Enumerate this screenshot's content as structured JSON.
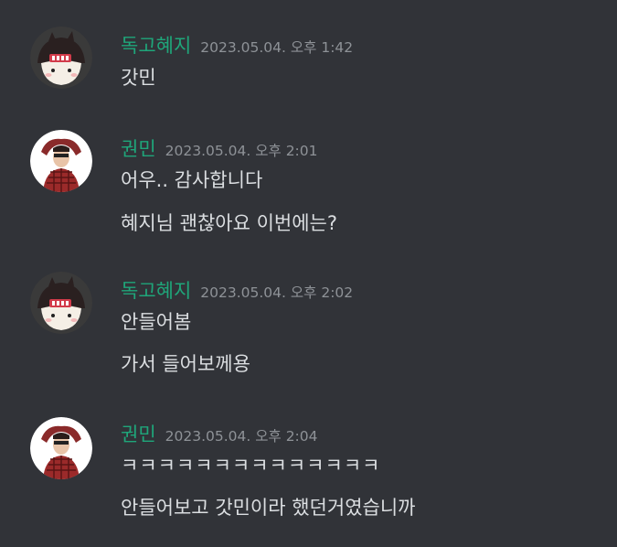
{
  "messages": [
    {
      "author": "독고혜지",
      "timestamp": "2023.05.04. 오후 1:42",
      "avatar": "dokgo-avatar-icon",
      "lines": [
        "갓민"
      ]
    },
    {
      "author": "권민",
      "timestamp": "2023.05.04. 오후 2:01",
      "avatar": "kwonmin-avatar-icon",
      "lines": [
        "어우.. 감사합니다",
        "혜지님 괜찮아요 이번에는?"
      ]
    },
    {
      "author": "독고혜지",
      "timestamp": "2023.05.04. 오후 2:02",
      "avatar": "dokgo-avatar-icon",
      "lines": [
        "안들어봄",
        "가서 들어보께용"
      ]
    },
    {
      "author": "권민",
      "timestamp": "2023.05.04. 오후 2:04",
      "avatar": "kwonmin-avatar-icon",
      "lines": [
        "ㅋㅋㅋㅋㅋㅋㅋㅋㅋㅋㅋㅋㅋㅋ",
        "안들어보고 갓민이라 했던거였습니까"
      ]
    }
  ],
  "colors": {
    "background": "#313338",
    "username": "#1fa67a",
    "timestamp": "#8e9297",
    "message_text": "#dbdee1"
  }
}
